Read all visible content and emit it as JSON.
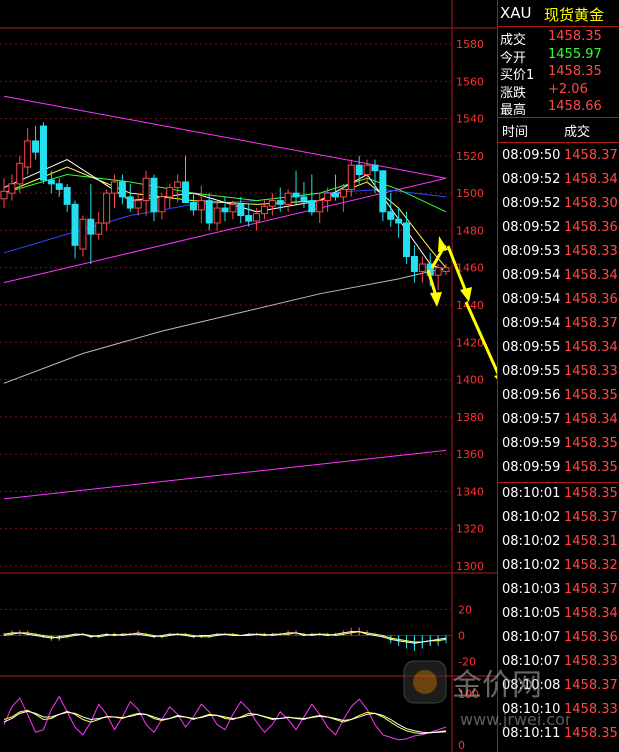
{
  "quote": {
    "symbol": "XAU",
    "name": "现货黄金",
    "rows": [
      {
        "label": "成交",
        "value": "1458.35",
        "color": "#ff4848"
      },
      {
        "label": "今开",
        "value": "1455.97",
        "color": "#33ff33"
      },
      {
        "label": "买价1",
        "value": "1458.35",
        "color": "#ff4848"
      },
      {
        "label": "涨跌",
        "value": "+2.06",
        "color": "#ff4848"
      },
      {
        "label": "最高",
        "value": "1458.66",
        "color": "#ff4848"
      }
    ]
  },
  "ticks": {
    "header_time": "时间",
    "header_price": "成交",
    "rows": [
      {
        "time": "08:09:50",
        "price": "1458.37"
      },
      {
        "time": "08:09:52",
        "price": "1458.34"
      },
      {
        "time": "08:09:52",
        "price": "1458.30"
      },
      {
        "time": "08:09:52",
        "price": "1458.36"
      },
      {
        "time": "08:09:53",
        "price": "1458.33"
      },
      {
        "time": "08:09:54",
        "price": "1458.34"
      },
      {
        "time": "08:09:54",
        "price": "1458.36"
      },
      {
        "time": "08:09:54",
        "price": "1458.37"
      },
      {
        "time": "08:09:55",
        "price": "1458.34"
      },
      {
        "time": "08:09:55",
        "price": "1458.33"
      },
      {
        "time": "08:09:56",
        "price": "1458.35"
      },
      {
        "time": "08:09:57",
        "price": "1458.34"
      },
      {
        "time": "08:09:59",
        "price": "1458.35"
      },
      {
        "time": "08:09:59",
        "price": "1458.35"
      },
      {
        "time": "08:10:01",
        "price": "1458.35"
      },
      {
        "time": "08:10:02",
        "price": "1458.37"
      },
      {
        "time": "08:10:02",
        "price": "1458.31"
      },
      {
        "time": "08:10:02",
        "price": "1458.32"
      },
      {
        "time": "08:10:03",
        "price": "1458.37"
      },
      {
        "time": "08:10:05",
        "price": "1458.34"
      },
      {
        "time": "08:10:07",
        "price": "1458.36"
      },
      {
        "time": "08:10:07",
        "price": "1458.33"
      },
      {
        "time": "08:10:08",
        "price": "1458.37"
      },
      {
        "time": "08:10:10",
        "price": "1458.33"
      },
      {
        "time": "08:10:11",
        "price": "1458.35"
      }
    ]
  },
  "watermark": {
    "text": "金价网",
    "url": "www.jrwei.com"
  },
  "chart_data": [
    {
      "type": "candlestick",
      "title": "",
      "ylim": [
        1300,
        1580
      ],
      "yticks": [
        1580,
        1560,
        1540,
        1520,
        1500,
        1480,
        1460,
        1440,
        1420,
        1400,
        1380,
        1360,
        1340,
        1320,
        1300
      ],
      "colors": {
        "up": "#ff4848",
        "down": "#22e0f0"
      },
      "candles": [
        {
          "o": 1497,
          "h": 1508,
          "l": 1492,
          "c": 1501
        },
        {
          "o": 1500,
          "h": 1510,
          "l": 1496,
          "c": 1505
        },
        {
          "o": 1505,
          "h": 1520,
          "l": 1500,
          "c": 1516
        },
        {
          "o": 1514,
          "h": 1535,
          "l": 1510,
          "c": 1528
        },
        {
          "o": 1528,
          "h": 1536,
          "l": 1518,
          "c": 1522
        },
        {
          "o": 1536,
          "h": 1538,
          "l": 1505,
          "c": 1507
        },
        {
          "o": 1507,
          "h": 1512,
          "l": 1500,
          "c": 1505
        },
        {
          "o": 1505,
          "h": 1508,
          "l": 1498,
          "c": 1502
        },
        {
          "o": 1503,
          "h": 1505,
          "l": 1490,
          "c": 1494
        },
        {
          "o": 1494,
          "h": 1496,
          "l": 1465,
          "c": 1472
        },
        {
          "o": 1470,
          "h": 1488,
          "l": 1466,
          "c": 1486
        },
        {
          "o": 1486,
          "h": 1505,
          "l": 1462,
          "c": 1478
        },
        {
          "o": 1478,
          "h": 1490,
          "l": 1475,
          "c": 1484
        },
        {
          "o": 1484,
          "h": 1502,
          "l": 1480,
          "c": 1500
        },
        {
          "o": 1500,
          "h": 1510,
          "l": 1492,
          "c": 1506
        },
        {
          "o": 1506,
          "h": 1510,
          "l": 1494,
          "c": 1498
        },
        {
          "o": 1498,
          "h": 1505,
          "l": 1490,
          "c": 1492
        },
        {
          "o": 1492,
          "h": 1500,
          "l": 1488,
          "c": 1496
        },
        {
          "o": 1496,
          "h": 1512,
          "l": 1488,
          "c": 1508
        },
        {
          "o": 1508,
          "h": 1510,
          "l": 1485,
          "c": 1490
        },
        {
          "o": 1490,
          "h": 1500,
          "l": 1486,
          "c": 1498
        },
        {
          "o": 1498,
          "h": 1505,
          "l": 1492,
          "c": 1503
        },
        {
          "o": 1503,
          "h": 1510,
          "l": 1495,
          "c": 1506
        },
        {
          "o": 1506,
          "h": 1520,
          "l": 1498,
          "c": 1495
        },
        {
          "o": 1495,
          "h": 1500,
          "l": 1488,
          "c": 1491
        },
        {
          "o": 1491,
          "h": 1504,
          "l": 1484,
          "c": 1496
        },
        {
          "o": 1496,
          "h": 1500,
          "l": 1480,
          "c": 1484
        },
        {
          "o": 1484,
          "h": 1495,
          "l": 1480,
          "c": 1492
        },
        {
          "o": 1492,
          "h": 1498,
          "l": 1485,
          "c": 1490
        },
        {
          "o": 1490,
          "h": 1496,
          "l": 1486,
          "c": 1494
        },
        {
          "o": 1494,
          "h": 1498,
          "l": 1484,
          "c": 1488
        },
        {
          "o": 1488,
          "h": 1494,
          "l": 1482,
          "c": 1485
        },
        {
          "o": 1485,
          "h": 1492,
          "l": 1480,
          "c": 1489
        },
        {
          "o": 1489,
          "h": 1496,
          "l": 1486,
          "c": 1493
        },
        {
          "o": 1493,
          "h": 1500,
          "l": 1488,
          "c": 1496
        },
        {
          "o": 1496,
          "h": 1503,
          "l": 1490,
          "c": 1494
        },
        {
          "o": 1494,
          "h": 1502,
          "l": 1490,
          "c": 1500
        },
        {
          "o": 1500,
          "h": 1512,
          "l": 1494,
          "c": 1498
        },
        {
          "o": 1498,
          "h": 1506,
          "l": 1492,
          "c": 1496
        },
        {
          "o": 1496,
          "h": 1510,
          "l": 1488,
          "c": 1490
        },
        {
          "o": 1490,
          "h": 1500,
          "l": 1484,
          "c": 1496
        },
        {
          "o": 1496,
          "h": 1503,
          "l": 1490,
          "c": 1500
        },
        {
          "o": 1500,
          "h": 1510,
          "l": 1496,
          "c": 1498
        },
        {
          "o": 1498,
          "h": 1505,
          "l": 1490,
          "c": 1502
        },
        {
          "o": 1502,
          "h": 1518,
          "l": 1498,
          "c": 1515
        },
        {
          "o": 1515,
          "h": 1520,
          "l": 1505,
          "c": 1510
        },
        {
          "o": 1510,
          "h": 1518,
          "l": 1505,
          "c": 1515
        },
        {
          "o": 1515,
          "h": 1518,
          "l": 1500,
          "c": 1512
        },
        {
          "o": 1512,
          "h": 1508,
          "l": 1485,
          "c": 1490
        },
        {
          "o": 1490,
          "h": 1500,
          "l": 1482,
          "c": 1486
        },
        {
          "o": 1486,
          "h": 1492,
          "l": 1476,
          "c": 1484
        },
        {
          "o": 1484,
          "h": 1490,
          "l": 1462,
          "c": 1466
        },
        {
          "o": 1466,
          "h": 1472,
          "l": 1452,
          "c": 1458
        },
        {
          "o": 1458,
          "h": 1466,
          "l": 1452,
          "c": 1462
        },
        {
          "o": 1462,
          "h": 1468,
          "l": 1450,
          "c": 1456
        },
        {
          "o": 1456,
          "h": 1462,
          "l": 1448,
          "c": 1460
        },
        {
          "o": 1458,
          "h": 1462,
          "l": 1456,
          "c": 1460
        }
      ],
      "overlays": [
        {
          "name": "upper-trendline",
          "color": "#ff33ff",
          "points": [
            [
              0,
              1552
            ],
            [
              56,
              1508
            ]
          ]
        },
        {
          "name": "lower-trendline",
          "color": "#ff33ff",
          "points": [
            [
              0,
              1452
            ],
            [
              56,
              1508
            ]
          ]
        },
        {
          "name": "long-support-line",
          "color": "#ff33ff",
          "points": [
            [
              0,
              1336
            ],
            [
              56,
              1362
            ]
          ]
        },
        {
          "name": "long-ma",
          "color": "#bbbbbb",
          "points": [
            [
              0,
              1398
            ],
            [
              10,
              1414
            ],
            [
              20,
              1426
            ],
            [
              30,
              1436
            ],
            [
              40,
              1446
            ],
            [
              50,
              1454
            ],
            [
              56,
              1460
            ]
          ]
        },
        {
          "name": "ma-blue",
          "color": "#3344ff",
          "points": [
            [
              0,
              1468
            ],
            [
              8,
              1478
            ],
            [
              16,
              1488
            ],
            [
              24,
              1494
            ],
            [
              32,
              1496
            ],
            [
              40,
              1500
            ],
            [
              48,
              1502
            ],
            [
              52,
              1500
            ],
            [
              56,
              1498
            ]
          ]
        },
        {
          "name": "ma-green",
          "color": "#33ff33",
          "points": [
            [
              0,
              1500
            ],
            [
              8,
              1510
            ],
            [
              16,
              1506
            ],
            [
              24,
              1500
            ],
            [
              32,
              1496
            ],
            [
              40,
              1500
            ],
            [
              46,
              1508
            ],
            [
              50,
              1502
            ],
            [
              56,
              1490
            ]
          ]
        },
        {
          "name": "ma-yellow",
          "color": "#ffff44",
          "points": [
            [
              0,
              1500
            ],
            [
              8,
              1514
            ],
            [
              16,
              1500
            ],
            [
              24,
              1496
            ],
            [
              32,
              1494
            ],
            [
              40,
              1496
            ],
            [
              46,
              1506
            ],
            [
              50,
              1492
            ],
            [
              54,
              1470
            ],
            [
              56,
              1460
            ]
          ]
        },
        {
          "name": "ma-white",
          "color": "#ffffff",
          "points": [
            [
              0,
              1503
            ],
            [
              8,
              1518
            ],
            [
              16,
              1496
            ],
            [
              24,
              1500
            ],
            [
              32,
              1490
            ],
            [
              40,
              1496
            ],
            [
              46,
              1510
            ],
            [
              50,
              1486
            ],
            [
              54,
              1462
            ],
            [
              56,
              1458
            ]
          ]
        }
      ]
    },
    {
      "type": "bar",
      "title": "",
      "ylim": [
        -25,
        35
      ],
      "yticks": [
        20,
        0,
        -20
      ],
      "series": [
        {
          "name": "",
          "color": "#ffff44",
          "values": [
            0,
            1,
            2,
            2,
            1,
            0,
            -1,
            -2,
            -1,
            0,
            1,
            0,
            -1,
            0,
            1,
            0,
            1,
            2,
            1,
            0,
            -1,
            0,
            1,
            1,
            0,
            -1,
            -1,
            0,
            1,
            1,
            0,
            0,
            1,
            1,
            0,
            1,
            1,
            2,
            1,
            0,
            1,
            1,
            0,
            1,
            2,
            3,
            2,
            1,
            0,
            -2,
            -3,
            -4,
            -5,
            -5,
            -4,
            -4,
            -3
          ]
        },
        {
          "name": "",
          "color": "#ffffff",
          "values": [
            1,
            2,
            2,
            1,
            0,
            -1,
            -2,
            -1,
            0,
            1,
            1,
            -1,
            0,
            1,
            0,
            1,
            1,
            1,
            0,
            -1,
            0,
            1,
            1,
            0,
            -1,
            0,
            0,
            1,
            1,
            0,
            0,
            1,
            1,
            0,
            1,
            1,
            2,
            2,
            0,
            1,
            1,
            0,
            1,
            2,
            3,
            3,
            1,
            0,
            -1,
            -3,
            -4,
            -5,
            -6,
            -5,
            -4,
            -3,
            -2
          ]
        }
      ]
    },
    {
      "type": "line",
      "title": "",
      "ylim": [
        0,
        100
      ],
      "yticks": [
        100,
        0
      ],
      "series": [
        {
          "name": "",
          "color": "#ff33ff",
          "values": [
            40,
            75,
            92,
            60,
            25,
            30,
            70,
            95,
            65,
            35,
            20,
            45,
            80,
            60,
            30,
            55,
            85,
            70,
            40,
            25,
            50,
            75,
            60,
            35,
            55,
            80,
            65,
            40,
            30,
            60,
            85,
            70,
            45,
            25,
            40,
            65,
            50,
            30,
            55,
            80,
            60,
            35,
            20,
            50,
            75,
            90,
            70,
            40,
            20,
            15,
            10,
            12,
            18,
            20,
            25,
            30,
            35
          ]
        },
        {
          "name": "",
          "color": "#ffff44",
          "values": [
            50,
            55,
            65,
            68,
            60,
            50,
            52,
            60,
            66,
            60,
            50,
            45,
            50,
            56,
            55,
            52,
            58,
            62,
            60,
            52,
            48,
            52,
            58,
            55,
            50,
            55,
            60,
            58,
            52,
            50,
            55,
            62,
            60,
            55,
            50,
            52,
            55,
            52,
            50,
            55,
            58,
            55,
            50,
            45,
            50,
            58,
            64,
            62,
            55,
            45,
            35,
            28,
            24,
            22,
            24,
            26,
            28
          ]
        },
        {
          "name": "",
          "color": "#ffffff",
          "values": [
            45,
            52,
            62,
            66,
            62,
            55,
            55,
            60,
            64,
            62,
            55,
            50,
            52,
            55,
            55,
            54,
            56,
            60,
            60,
            55,
            50,
            52,
            56,
            55,
            52,
            54,
            58,
            58,
            55,
            52,
            54,
            58,
            60,
            56,
            52,
            52,
            54,
            53,
            52,
            54,
            56,
            55,
            52,
            48,
            50,
            55,
            60,
            62,
            58,
            50,
            40,
            32,
            28,
            25,
            24,
            25,
            26
          ]
        }
      ]
    }
  ]
}
